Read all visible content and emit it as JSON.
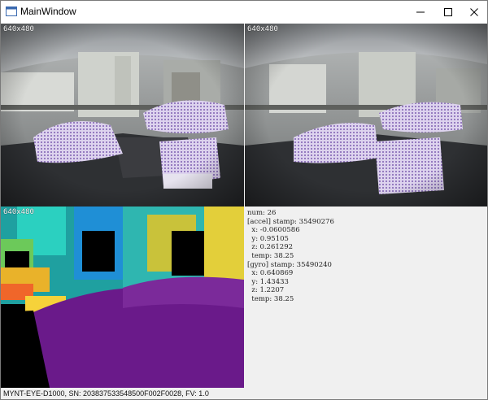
{
  "window": {
    "title": "MainWindow"
  },
  "left_image": {
    "resolution": "640x480"
  },
  "right_image": {
    "resolution": "640x480"
  },
  "depth_image": {
    "resolution": "640x480"
  },
  "imu": {
    "num": "num: 26",
    "accel_header": "[accel] stamp: 35490276",
    "accel_x": "  x: -0.0600586",
    "accel_y": "  y: 0.95105",
    "accel_z": "  z: 0.261292",
    "accel_temp": "  temp: 38.25",
    "gyro_header": "[gyro] stamp: 35490240",
    "gyro_x": "  x: 0.640869",
    "gyro_y": "  y: 1.43433",
    "gyro_z": "  z: 1.2207",
    "gyro_temp": "  temp: 38.25"
  },
  "status_bar": {
    "text": "MYNT-EYE-D1000, SN: 203837533548500F002F0028, FV: 1.0"
  },
  "colors": {
    "depth_far": "#1f8fd6",
    "depth_near": "#6a1a8a",
    "title_bg": "#ffffff",
    "panel_bg": "#f0f0f0"
  }
}
